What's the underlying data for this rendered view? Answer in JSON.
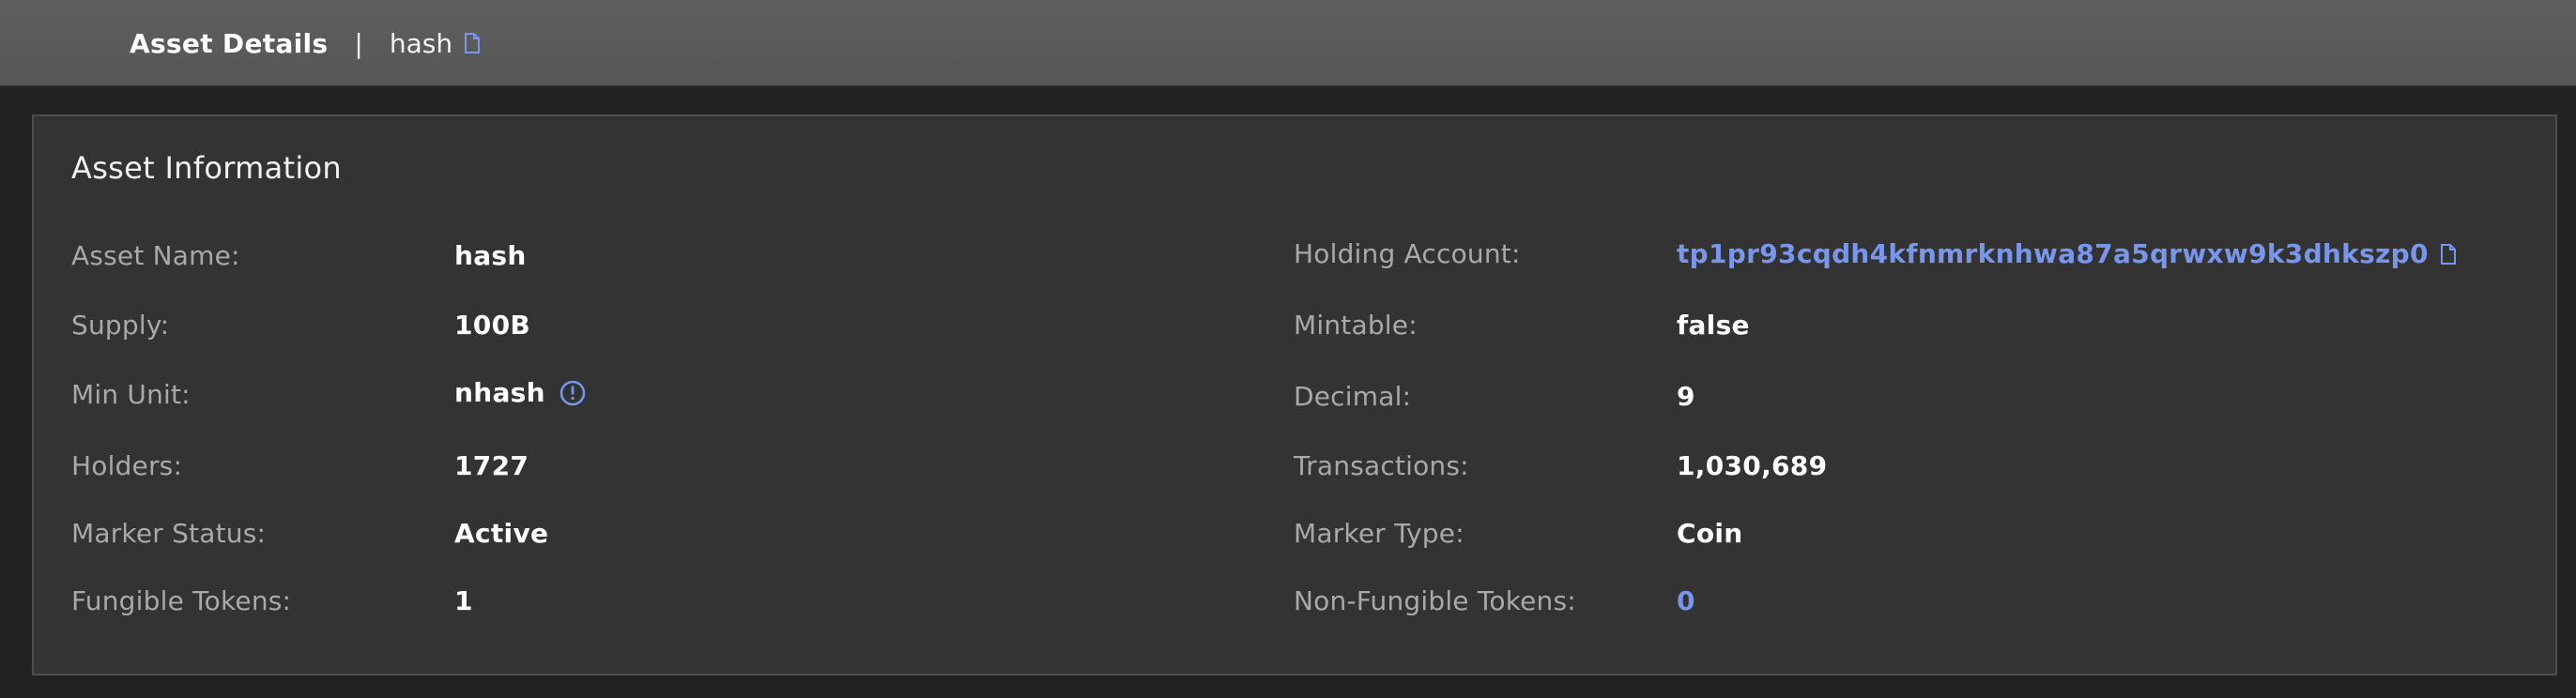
{
  "header": {
    "title": "Asset Details",
    "separator": "|",
    "asset": "hash"
  },
  "card": {
    "title": "Asset Information"
  },
  "left": [
    {
      "label": "Asset Name:",
      "value": "hash"
    },
    {
      "label": "Supply:",
      "value": "100B"
    },
    {
      "label": "Min Unit:",
      "value": "nhash"
    },
    {
      "label": "Holders:",
      "value": "1727"
    },
    {
      "label": "Marker Status:",
      "value": "Active"
    },
    {
      "label": "Fungible Tokens:",
      "value": "1"
    }
  ],
  "right": [
    {
      "label": "Holding Account:",
      "value": "tp1pr93cqdh4kfnmrknhwa87a5qrwxw9k3dhkszp0"
    },
    {
      "label": "Mintable:",
      "value": "false"
    },
    {
      "label": "Decimal:",
      "value": "9"
    },
    {
      "label": "Transactions:",
      "value": "1,030,689"
    },
    {
      "label": "Marker Type:",
      "value": "Coin"
    },
    {
      "label": "Non-Fungible Tokens:",
      "value": "0"
    }
  ],
  "colors": {
    "link": "#7896ec",
    "background": "#222222",
    "card": "#333333",
    "header": "#5a5a5a"
  },
  "icons": {
    "copy": "copy-icon",
    "info": "info-icon"
  }
}
